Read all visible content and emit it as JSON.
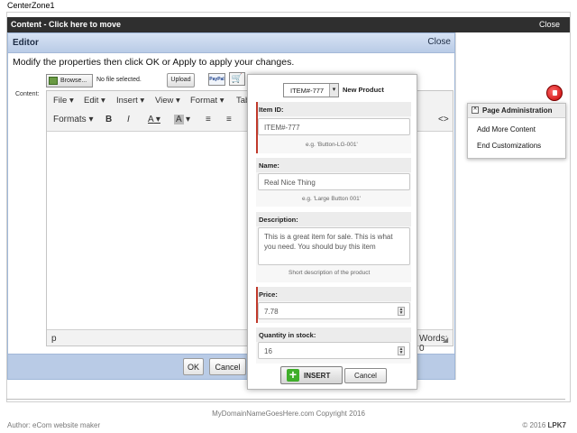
{
  "zone_label": "CenterZone1",
  "content_bar": {
    "title": "Content - Click here to move",
    "close": "Close"
  },
  "editor": {
    "title": "Editor",
    "close": "Close",
    "instructions": "Modify the properties then click OK or Apply to apply your changes.",
    "content_label": "Content:",
    "browse_label": "Browse...",
    "file_label": "No file selected.",
    "upload_label": "Upload",
    "paypal_label": "PayPal",
    "menubar": [
      "File",
      "Edit",
      "Insert",
      "View",
      "Format",
      "Tab"
    ],
    "toolbar": {
      "formats": "Formats",
      "bold": "B",
      "italic": "I",
      "font_color": "A",
      "bg_color": "A",
      "code": "<>"
    },
    "status_path": "p",
    "word_count": "Words: 0",
    "ok_label": "OK",
    "cancel_label": "Cancel"
  },
  "product_dialog": {
    "selected_item": "ITEM#-777",
    "new_product": "New Product",
    "item_id": {
      "label": "Item ID:",
      "value": "ITEM#-777",
      "hint": "e.g. 'Button-LG-001'"
    },
    "name": {
      "label": "Name:",
      "value": "Real Nice Thing",
      "hint": "e.g. 'Large Button 001'"
    },
    "description": {
      "label": "Description:",
      "value": "This is a great item for sale. This is what you need. You should buy this item",
      "hint": "Short description of the product"
    },
    "price": {
      "label": "Price:",
      "value": "7.78"
    },
    "quantity": {
      "label": "Quantity in stock:",
      "value": "16"
    },
    "insert_label": "INSERT",
    "cancel_label": "Cancel"
  },
  "page_admin": {
    "title": "Page Administration",
    "links": [
      "Add More Content",
      "End Customizations"
    ]
  },
  "footer": {
    "copyright": "MyDomainNameGoesHere.com Copyright 2016",
    "author": "Author: eCom website maker",
    "right_prefix": "© 2016",
    "right_brand": "LPK7"
  },
  "colors": {
    "accent_green": "#3fae2a",
    "required_red": "#c0392b",
    "header_blue": "#b9cbe6",
    "dark_bar": "#2f2f2f"
  }
}
